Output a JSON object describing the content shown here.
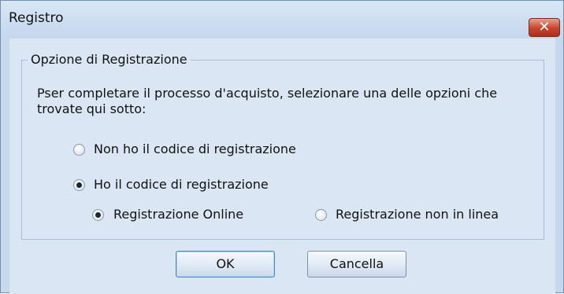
{
  "window": {
    "title": "Registro",
    "close_label": "✕"
  },
  "group": {
    "legend": "Opzione di Registrazione",
    "description": "Pser completare il processo d'acquisto, selezionare una delle opzioni che trovate qui sotto:"
  },
  "options": {
    "no_code": {
      "label": "Non ho il codice di registrazione",
      "checked": false
    },
    "have_code": {
      "label": "Ho il codice di registrazione",
      "checked": true
    },
    "online": {
      "label": "Registrazione Online",
      "checked": true
    },
    "offline": {
      "label": "Registrazione non in linea",
      "checked": false
    }
  },
  "buttons": {
    "ok": "OK",
    "cancel": "Cancella"
  }
}
